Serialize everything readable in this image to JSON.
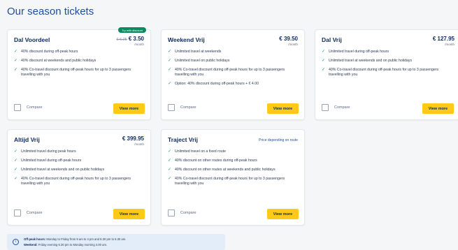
{
  "page": {
    "title": "Our season tickets"
  },
  "compare_label": "Compare",
  "view_more_label": "View more",
  "cards": [
    {
      "name": "Dal Voordeel",
      "old_price": "€ 6.25",
      "price": "€ 3.50",
      "period": "/month",
      "badge": "Try with discount",
      "features": [
        "40% discount during off-peak hours",
        "40% discount at weekends and public holidays",
        "40% Co-travel discount during off-peak hours for up to 3 passengers travelling with you"
      ]
    },
    {
      "name": "Weekend Vrij",
      "price": "€ 39.50",
      "period": "/month",
      "features": [
        "Unlimited travel at weekends",
        "Unlimited travel on public holidays",
        "40% Co-travel discount during off-peak hours for up to 3 passengers travelling with you",
        "Option: 40% discount during off-peak hours + € 4.00"
      ]
    },
    {
      "name": "Dal Vrij",
      "price": "€ 127.95",
      "period": "/month",
      "features": [
        "Unlimited travel during off-peak hours",
        "Unlimited travel at weekends and on public holidays",
        "40% Co-travel discount during off-peak hours for up to 3 passengers travelling with you"
      ]
    },
    {
      "name": "Altijd Vrij",
      "price": "€ 399.95",
      "period": "/month",
      "features": [
        "Unlimited travel during peak hours",
        "Unlimited travel during off-peak hours",
        "Unlimited travel at weekends and on public holidays",
        "40% Co-travel discount during off-peak hours for up to 3 passengers travelling with you"
      ]
    },
    {
      "name": "Traject Vrij",
      "route_note": "Price depending on route",
      "features": [
        "Unlimited travel on a fixed route",
        "40% discount on other routes during off-peak hours",
        "40% discount on other routes at weekends and public holidays",
        "40% Co-travel discount during off-peak hours for up to 3 passengers travelling with you"
      ]
    }
  ],
  "info": {
    "icon": "info-icon",
    "offpeak_label": "Off-peak hours:",
    "offpeak_text": "Monday to Friday from 9 am to 4 pm and 6.30 pm to 6.30 am.",
    "weekend_label": "Weekend:",
    "weekend_text": "Friday evening 6.30 pm to Monday morning 4.00 am."
  }
}
